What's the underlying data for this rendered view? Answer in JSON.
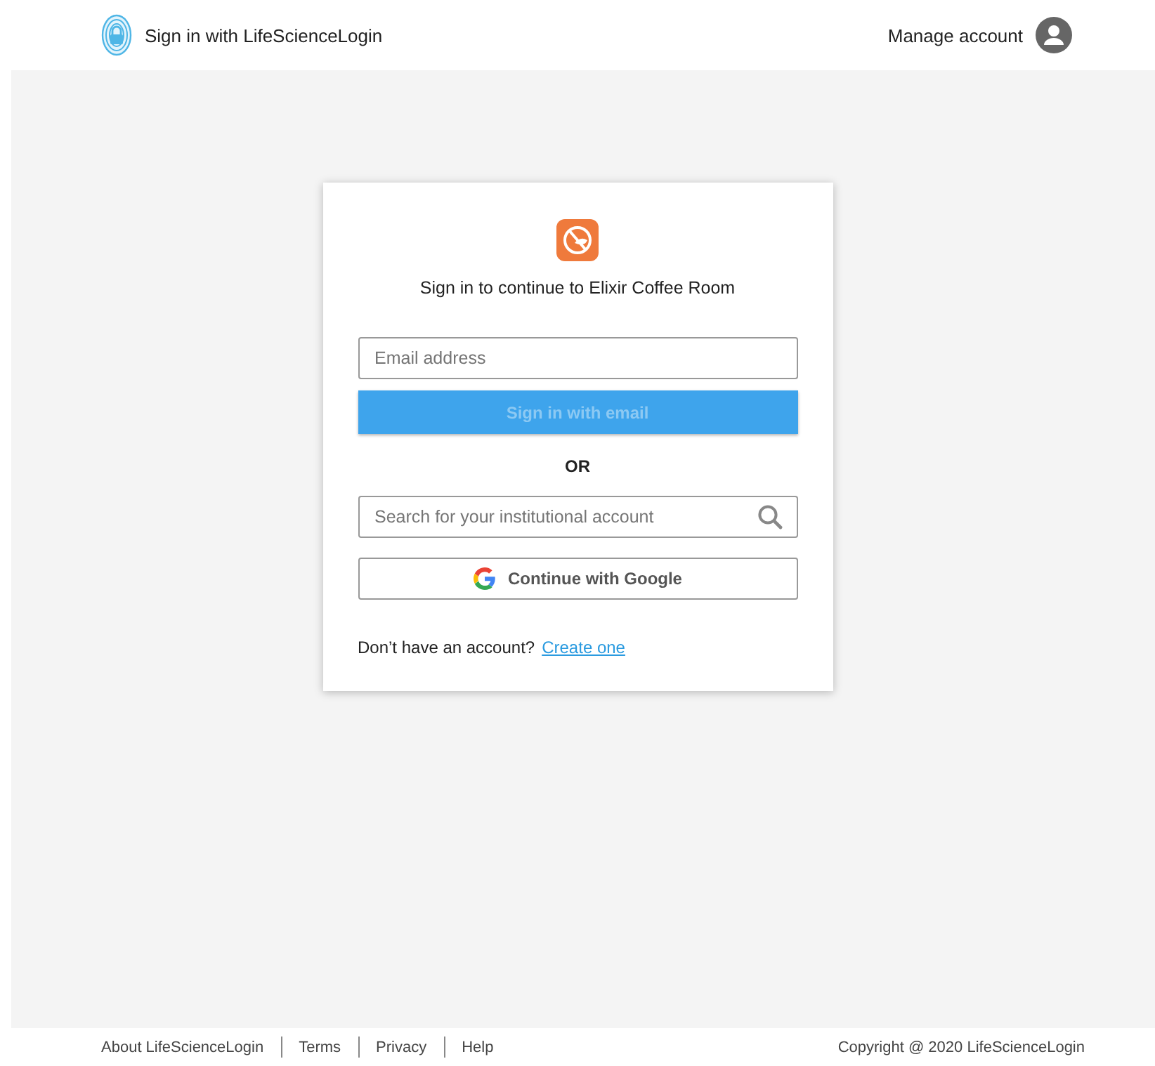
{
  "header": {
    "title": "Sign in with LifeScienceLogin",
    "account_label": "Manage account"
  },
  "card": {
    "heading": "Sign in to continue to Elixir Coffee Room",
    "email_field": {
      "placeholder": "Email address"
    },
    "email_button": {
      "label": "Sign in with email",
      "disabled": true
    },
    "divider": "OR",
    "search_field": {
      "placeholder": "Search for your institutional account"
    },
    "google_button": {
      "label": "Continue with Google"
    },
    "signup_prompt": "Don’t have an account?",
    "signup_link": "Create one"
  },
  "footer": {
    "links": [
      "About LifeScienceLogin",
      "Terms",
      "Privacy",
      "Help"
    ],
    "copyright": "Copyright @ 2020 LifeScienceLogin"
  }
}
